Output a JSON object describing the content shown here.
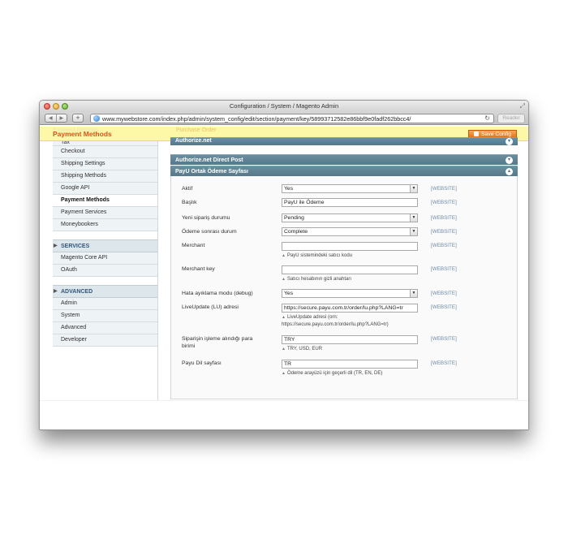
{
  "window": {
    "title": "Configuration / System / Magento Admin",
    "url": "www.mywebstore.com/index.php/admin/system_config/edit/section/payment/key/58993712582e86bbf9e0fadf262bbcc4/",
    "reader_label": "Reader"
  },
  "header": {
    "title": "Payment Methods",
    "ghost_left": "Payment Methods",
    "ghost_right": "Purchase Order",
    "save_label": "Save Config"
  },
  "sidebar": {
    "items_top": [
      {
        "label": "Tax"
      },
      {
        "label": "Checkout"
      },
      {
        "label": "Shipping Settings"
      },
      {
        "label": "Shipping Methods"
      },
      {
        "label": "Google API"
      },
      {
        "label": "Payment Methods"
      },
      {
        "label": "Payment Services"
      },
      {
        "label": "Moneybookers"
      }
    ],
    "services_head": "SERVICES",
    "services_items": [
      {
        "label": "Magento Core API"
      },
      {
        "label": "OAuth"
      }
    ],
    "advanced_head": "ADVANCED",
    "advanced_items": [
      {
        "label": "Admin"
      },
      {
        "label": "System"
      },
      {
        "label": "Advanced"
      },
      {
        "label": "Developer"
      }
    ]
  },
  "sections": {
    "s1": "Authorize.net",
    "s2": "Authorize.net Direct Post",
    "s3": "PayU Ortak Ödeme Sayfası"
  },
  "form": {
    "scope": "[WEBSITE]",
    "aktif": {
      "label": "Aktif",
      "value": "Yes"
    },
    "baslik": {
      "label": "Başlık",
      "value": "PayU ile Ödeme"
    },
    "yeni": {
      "label": "Yeni sipariş durumu",
      "value": "Pending"
    },
    "odeme": {
      "label": "Ödeme sonrası durum",
      "value": "Complete"
    },
    "merchant": {
      "label": "Merchant",
      "value": "",
      "note": "PayU sistemindeki satıcı kodu"
    },
    "merchant_key": {
      "label": "Merchant key",
      "value": "",
      "note": "Satıcı hesabının gizli anahtarı"
    },
    "debug": {
      "label": "Hata ayıklama modu (debug)",
      "value": "Yes"
    },
    "liveupdate": {
      "label": "LiveUpdate (LU) adresi",
      "value": "https://secure.payu.com.tr/order/lu.php?LANG=tr",
      "note1": "LiveUpdate adresi (orn:",
      "note2": "https://secure.payu.com.tr/order/lu.php?LANG=tr)"
    },
    "currency": {
      "label1": "Siparişin işleme alındığı para",
      "label2": "birimi",
      "value": "TRY",
      "note": "TRY, USD, EUR"
    },
    "lang": {
      "label": "Payu Dil sayfası",
      "value": "TR",
      "note": "Ödeme arayüzü için geçerli dil (TR, EN, DE)"
    }
  }
}
